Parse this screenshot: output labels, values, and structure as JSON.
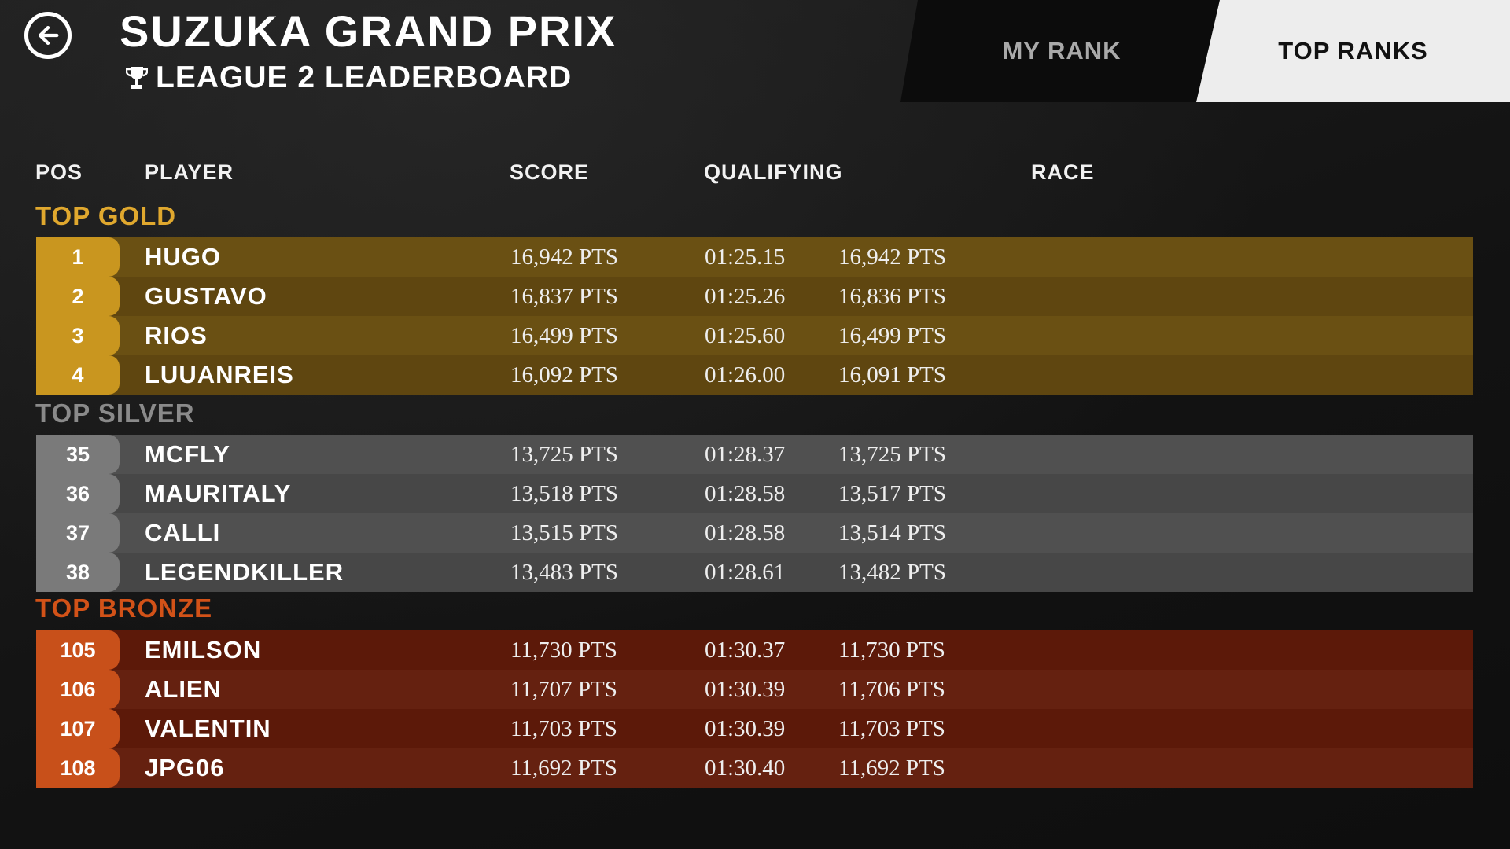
{
  "header": {
    "back_icon": "arrow-left-circle-icon",
    "title": "SUZUKA GRAND PRIX",
    "trophy_icon": "trophy-icon",
    "subtitle": "LEAGUE 2 LEADERBOARD"
  },
  "tabs": [
    {
      "label": "MY RANK",
      "active": false
    },
    {
      "label": "TOP RANKS",
      "active": true
    }
  ],
  "columns": {
    "pos": "POS",
    "player": "PLAYER",
    "score": "SCORE",
    "qualifying": "QUALIFYING",
    "race": "RACE"
  },
  "sections": [
    {
      "label": "TOP GOLD",
      "colors": {
        "label": "#e0a82e",
        "row_a": "#6a5013",
        "row_b": "#5f4610",
        "badge": "#c9961f"
      },
      "rows": [
        {
          "pos": "1",
          "player": "HUGO",
          "score": "16,942 PTS",
          "qual_time": "01:25.15",
          "qual_score": "16,942 PTS"
        },
        {
          "pos": "2",
          "player": "GUSTAVO",
          "score": "16,837 PTS",
          "qual_time": "01:25.26",
          "qual_score": "16,836 PTS"
        },
        {
          "pos": "3",
          "player": "RIOS",
          "score": "16,499 PTS",
          "qual_time": "01:25.60",
          "qual_score": "16,499 PTS"
        },
        {
          "pos": "4",
          "player": "LUUANREIS",
          "score": "16,092 PTS",
          "qual_time": "01:26.00",
          "qual_score": "16,091 PTS"
        }
      ]
    },
    {
      "label": "TOP SILVER",
      "colors": {
        "label": "#8a8a8a",
        "row_a": "#505050",
        "row_b": "#474747",
        "badge": "#7a7a7a"
      },
      "rows": [
        {
          "pos": "35",
          "player": "MCFLY",
          "score": "13,725 PTS",
          "qual_time": "01:28.37",
          "qual_score": "13,725 PTS"
        },
        {
          "pos": "36",
          "player": "MAURITALY",
          "score": "13,518 PTS",
          "qual_time": "01:28.58",
          "qual_score": "13,517 PTS"
        },
        {
          "pos": "37",
          "player": "CALLI",
          "score": "13,515 PTS",
          "qual_time": "01:28.58",
          "qual_score": "13,514 PTS"
        },
        {
          "pos": "38",
          "player": "LEGENDKILLER",
          "score": "13,483 PTS",
          "qual_time": "01:28.61",
          "qual_score": "13,482 PTS"
        }
      ]
    },
    {
      "label": "TOP BRONZE",
      "colors": {
        "label": "#d25218",
        "row_a": "#5c1909",
        "row_b": "#652110",
        "badge": "#c8501a"
      },
      "rows": [
        {
          "pos": "105",
          "player": "EMILSON",
          "score": "11,730 PTS",
          "qual_time": "01:30.37",
          "qual_score": "11,730 PTS"
        },
        {
          "pos": "106",
          "player": "ALIEN",
          "score": "11,707 PTS",
          "qual_time": "01:30.39",
          "qual_score": "11,706 PTS"
        },
        {
          "pos": "107",
          "player": "VALENTIN",
          "score": "11,703 PTS",
          "qual_time": "01:30.39",
          "qual_score": "11,703 PTS"
        },
        {
          "pos": "108",
          "player": "JPG06",
          "score": "11,692 PTS",
          "qual_time": "01:30.40",
          "qual_score": "11,692 PTS"
        }
      ]
    }
  ]
}
